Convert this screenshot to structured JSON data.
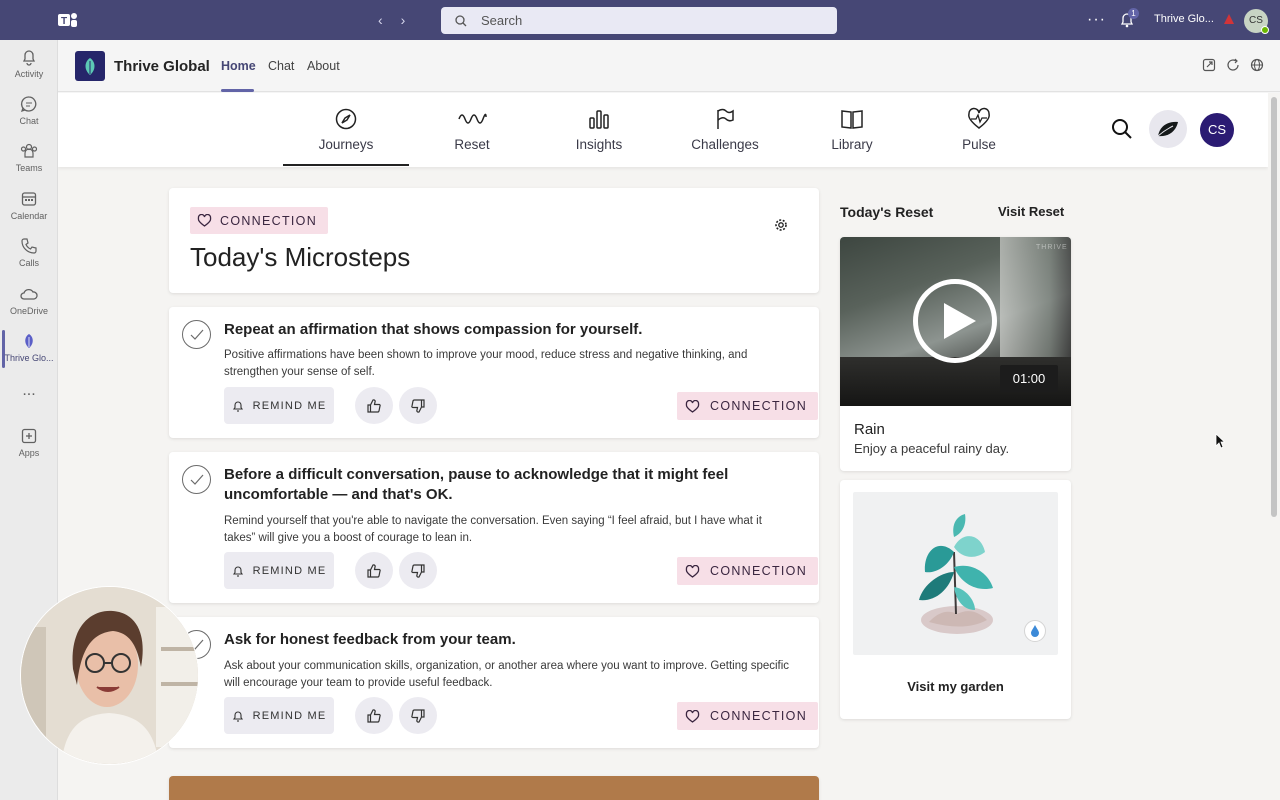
{
  "topbar": {
    "search_placeholder": "Search",
    "notifications_count": "1",
    "user_name": "Thrive Glo...",
    "avatar_initials": "CS"
  },
  "rail": {
    "items": [
      {
        "label": "Activity",
        "icon": "bell-icon"
      },
      {
        "label": "Chat",
        "icon": "chat-icon"
      },
      {
        "label": "Teams",
        "icon": "teams-icon"
      },
      {
        "label": "Calendar",
        "icon": "calendar-icon"
      },
      {
        "label": "Calls",
        "icon": "phone-icon"
      },
      {
        "label": "OneDrive",
        "icon": "cloud-icon"
      },
      {
        "label": "Thrive Glo...",
        "icon": "thrive-leaf-icon"
      },
      {
        "label": "Apps",
        "icon": "plus-square-icon"
      }
    ],
    "more": "..."
  },
  "appbar": {
    "title": "Thrive Global",
    "tabs": [
      {
        "label": "Home",
        "active": true
      },
      {
        "label": "Chat",
        "active": false
      },
      {
        "label": "About",
        "active": false
      }
    ]
  },
  "thrive_nav": {
    "items": [
      {
        "label": "Journeys",
        "icon": "compass-icon",
        "active": true
      },
      {
        "label": "Reset",
        "icon": "wave-icon",
        "active": false
      },
      {
        "label": "Insights",
        "icon": "bar-chart-icon",
        "active": false
      },
      {
        "label": "Challenges",
        "icon": "flag-icon",
        "active": false
      },
      {
        "label": "Library",
        "icon": "book-icon",
        "active": false
      },
      {
        "label": "Pulse",
        "icon": "heart-pulse-icon",
        "active": false
      }
    ],
    "avatar_initials": "CS"
  },
  "microsteps": {
    "chip": "CONNECTION",
    "heading": "Today's Microsteps",
    "remind_label": "REMIND ME",
    "items": [
      {
        "title": "Repeat an affirmation that shows compassion for yourself.",
        "description": "Positive affirmations have been shown to improve your mood, reduce stress and negative thinking, and strengthen your sense of self.",
        "tag": "CONNECTION"
      },
      {
        "title": "Before a difficult conversation, pause to acknowledge that it might feel uncomfortable — and that's OK.",
        "description": "Remind yourself that you're able to navigate the conversation. Even saying “I feel afraid, but I have what it takes” will give you a boost of courage to lean in.",
        "tag": "CONNECTION"
      },
      {
        "title": "Ask for honest feedback from your team.",
        "description": "Ask about your communication skills, organization, or another area where you want to improve. Getting specific will encourage your team to provide useful feedback.",
        "tag": "CONNECTION"
      }
    ]
  },
  "reset": {
    "heading": "Today's Reset",
    "link": "Visit Reset",
    "video_title": "Rain",
    "video_subtitle": "Enjoy a peaceful rainy day.",
    "duration": "01:00",
    "watermark": "THRIVE"
  },
  "garden": {
    "link": "Visit my garden"
  },
  "colors": {
    "teams_purple": "#464775",
    "accent": "#6264a7",
    "chip_bg": "#f7dfe7",
    "avatar_navy": "#2b1b73"
  }
}
